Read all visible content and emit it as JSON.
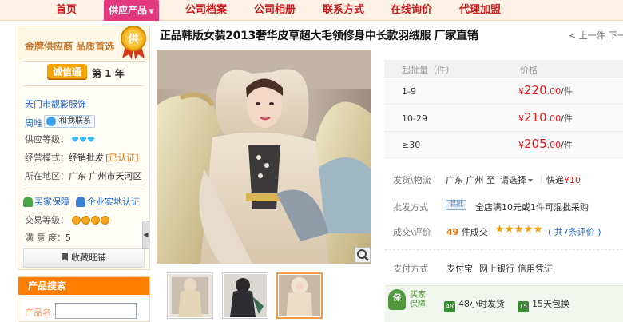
{
  "nav": {
    "items": [
      "首页",
      "供应产品",
      "公司档案",
      "公司相册",
      "联系方式",
      "在线询价",
      "代理加盟"
    ]
  },
  "sidebar": {
    "gold_supplier_text": "金牌供应商 品质首选",
    "badge_text": "供",
    "chengxintong": "诚信通",
    "cxt_years": "第 1 年",
    "company_name": "天门市靓影服饰",
    "contact_name": "周唯",
    "talk_button": "和我联系",
    "supply_level_label": "供应等级：",
    "business_model_label": "经营模式：",
    "business_model_value": "经销批发",
    "verified_text": "[已认证]",
    "region_label": "所在地区：",
    "region_value": "广东 广州市天河区",
    "buyer_protection": "买家保障",
    "onsite_cert": "企业实地认证",
    "trade_level_label": "交易等级：",
    "satisfaction_label": "满 意 度：",
    "satisfaction_value": "5",
    "favorite_button": "收藏旺铺",
    "collapse_arrow": "◀"
  },
  "search": {
    "title": "产品搜索",
    "label": "产品名",
    "input_value": ""
  },
  "product": {
    "title": "正品韩版女装2013奢华皮草超大毛领修身中长款羽绒服 厂家直销",
    "prev": "< 上一件",
    "next": "下一"
  },
  "price_table": {
    "qty_header": "起批量（件）",
    "price_header": "价格",
    "rows": [
      {
        "qty": "1-9",
        "price_int": "220",
        "price_dec": ".00",
        "unit": "/件"
      },
      {
        "qty": "10-29",
        "price_int": "210",
        "price_dec": ".00",
        "unit": "/件"
      },
      {
        "qty": "≥30",
        "price_int": "205",
        "price_dec": ".00",
        "unit": "/件"
      }
    ],
    "currency": "¥"
  },
  "details": {
    "shipping_label": "发货\\物流",
    "shipping_from": "广东 广州 至",
    "shipping_select": "请选择",
    "shipping_express": "快递",
    "shipping_fee": "¥10",
    "wholesale_label": "批发方式",
    "mix_badge": "混批",
    "wholesale_text": "全店满10元或1件可混批采购",
    "deals_label": "成交\\评价",
    "deals_count": "49",
    "deals_unit": "件成交",
    "review_text": "( 共7条评价 )",
    "star_count": 5,
    "payment_label": "支付方式",
    "payment_methods": [
      "支付宝",
      "网上银行",
      "信用凭证"
    ]
  },
  "guarantee": {
    "shield_text": "保",
    "label": "买家保障",
    "items": [
      {
        "icon": "48",
        "text": "48小时发货"
      },
      {
        "icon": "15",
        "text": "15天包换"
      }
    ]
  },
  "colors": {
    "nav_text": "#c81e1e",
    "nav_active_bg": "#e1387e",
    "price_red": "#e31a1a",
    "search_header": "#ff7e00",
    "guarantee_green": "#4f9a3d"
  },
  "icons": [
    "gold-badge-icon",
    "talk-icon",
    "diamond-icon",
    "crown-icon",
    "buyer-protection-icon",
    "onsite-cert-icon",
    "bookmark-icon",
    "zoom-icon",
    "star-icon",
    "guarantee-shield-icon",
    "dropdown-caret-icon"
  ]
}
